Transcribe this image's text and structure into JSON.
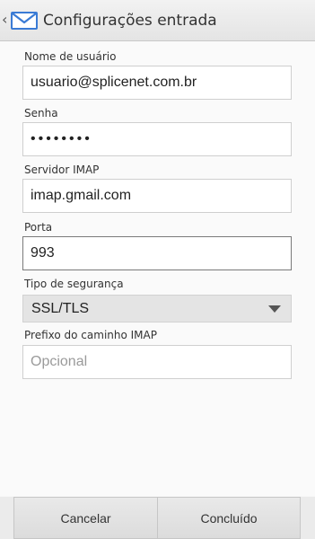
{
  "header": {
    "title": "Configurações entrada",
    "icon": "mail-icon"
  },
  "form": {
    "username": {
      "label": "Nome de usuário",
      "value": "usuario@splicenet.com.br"
    },
    "password": {
      "label": "Senha",
      "value": "••••••••"
    },
    "imap_server": {
      "label": "Servidor IMAP",
      "value": "imap.gmail.com"
    },
    "port": {
      "label": "Porta",
      "value": "993"
    },
    "security": {
      "label": "Tipo de segurança",
      "selected": "SSL/TLS"
    },
    "imap_prefix": {
      "label": "Prefixo do caminho IMAP",
      "value": "",
      "placeholder": "Opcional"
    }
  },
  "actions": {
    "cancel_label": "Cancelar",
    "done_label": "Concluído"
  },
  "colors": {
    "mail_icon_blue": "#3a7bd5"
  }
}
